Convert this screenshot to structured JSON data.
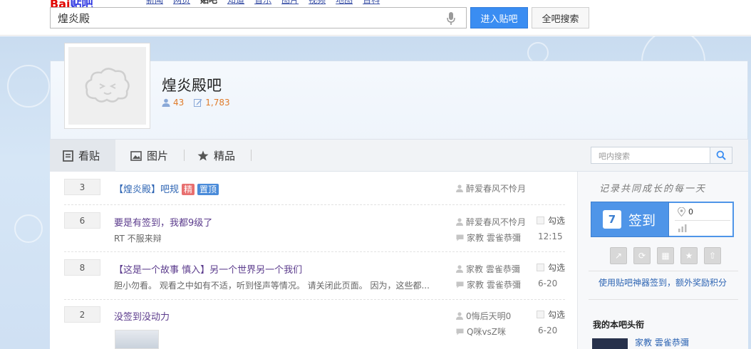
{
  "top": {
    "logo_red": "Bai",
    "logo_blue": "贴吧",
    "nav": [
      "新闻",
      "网页",
      "贴吧",
      "知道",
      "音乐",
      "图片",
      "视频",
      "地图",
      "百科"
    ],
    "search_value": "煌炎殿",
    "enter_btn": "进入贴吧",
    "all_btn": "全吧搜索"
  },
  "forum": {
    "name": "煌炎殿吧",
    "members": "43",
    "posts": "1,783"
  },
  "tabs": [
    {
      "label": "看贴",
      "icon": "doc-icon"
    },
    {
      "label": "图片",
      "icon": "image-icon"
    },
    {
      "label": "精品",
      "icon": "star-icon"
    }
  ],
  "inner_search": {
    "placeholder": "吧内搜索"
  },
  "threads": [
    {
      "replies": "3",
      "title": "【煌炎殿】吧规",
      "tags": [
        "精",
        "置顶"
      ],
      "author": "醉爱春风不怜月",
      "abstract": "",
      "last_reply": "",
      "time": "",
      "pick": ""
    },
    {
      "replies": "6",
      "title": "要是有签到，我都9级了",
      "tags": [],
      "author": "醉爱春风不怜月",
      "abstract": "RT 不服来辩",
      "last_reply": "家教 雲雀恭彌",
      "time": "12:15",
      "pick": "勾选"
    },
    {
      "replies": "8",
      "title": "【这是一个故事 慎入】另一个世界另一个我们",
      "tags": [],
      "author": "家教 雲雀恭彌",
      "abstract": "胆小勿看。 观看之中如有不适，听到怪声等情况。 请关闭此页面。 因为，这些都...",
      "last_reply": "家教 雲雀恭彌",
      "time": "6-20",
      "pick": "勾选"
    },
    {
      "replies": "2",
      "title": "没签到没动力",
      "tags": [],
      "author": "0悔后天明0",
      "abstract": "",
      "last_reply": "Q咪vsZ咪",
      "time": "6-20",
      "pick": "勾选"
    }
  ],
  "sidebar": {
    "slogan": "记录共同成长的每一天",
    "signin_label": "签到",
    "calendar_day": "7",
    "signin_count": "0",
    "tools": [
      "tool-1",
      "tool-2",
      "tool-3",
      "tool-4",
      "tool-5"
    ],
    "link": "使用贴吧神器签到，额外奖励积分",
    "hot_title": "我的本吧头衔",
    "hot_name": "家教 雲雀恭彌"
  }
}
